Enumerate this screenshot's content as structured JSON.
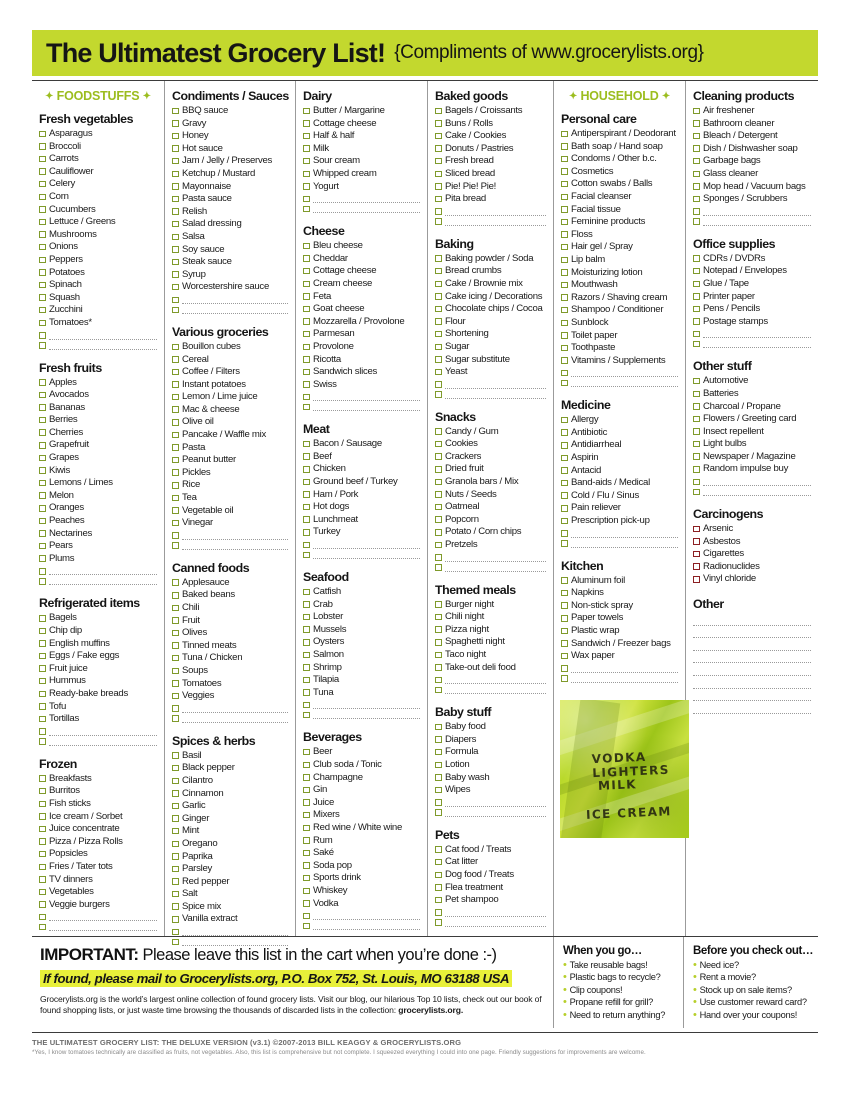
{
  "header": {
    "title": "The Ultimatest Grocery List!",
    "subtitle": "{Compliments of www.grocerylists.org}"
  },
  "banners": {
    "foodstuffs": "FOODSTUFFS",
    "household": "HOUSEHOLD"
  },
  "columns": [
    {
      "banner": "foodstuffs",
      "sections": [
        {
          "title": "Fresh vegetables",
          "items": [
            "Asparagus",
            "Broccoli",
            "Carrots",
            "Cauliflower",
            "Celery",
            "Corn",
            "Cucumbers",
            "Lettuce / Greens",
            "Mushrooms",
            "Onions",
            "Peppers",
            "Potatoes",
            "Spinach",
            "Squash",
            "Zucchini",
            "Tomatoes*"
          ],
          "blanks": 2
        },
        {
          "title": "Fresh fruits",
          "items": [
            "Apples",
            "Avocados",
            "Bananas",
            "Berries",
            "Cherries",
            "Grapefruit",
            "Grapes",
            "Kiwis",
            "Lemons / Limes",
            "Melon",
            "Oranges",
            "Peaches",
            "Nectarines",
            "Pears",
            "Plums"
          ],
          "blanks": 2
        },
        {
          "title": "Refrigerated items",
          "items": [
            "Bagels",
            "Chip dip",
            "English muffins",
            "Eggs / Fake eggs",
            "Fruit juice",
            "Hummus",
            "Ready-bake breads",
            "Tofu",
            "Tortillas"
          ],
          "blanks": 2
        },
        {
          "title": "Frozen",
          "items": [
            "Breakfasts",
            "Burritos",
            "Fish sticks",
            "Ice cream / Sorbet",
            "Juice concentrate",
            "Pizza / Pizza Rolls",
            "Popsicles",
            "Fries / Tater tots",
            "TV dinners",
            "Vegetables",
            "Veggie burgers"
          ],
          "blanks": 2
        }
      ]
    },
    {
      "sections": [
        {
          "title": "Condiments / Sauces",
          "items": [
            "BBQ sauce",
            "Gravy",
            "Honey",
            "Hot sauce",
            "Jam / Jelly / Preserves",
            "Ketchup / Mustard",
            "Mayonnaise",
            "Pasta sauce",
            "Relish",
            "Salad dressing",
            "Salsa",
            "Soy sauce",
            "Steak sauce",
            "Syrup",
            "Worcestershire sauce"
          ],
          "blanks": 2
        },
        {
          "title": "Various groceries",
          "items": [
            "Bouillon cubes",
            "Cereal",
            "Coffee / Filters",
            "Instant potatoes",
            "Lemon / Lime juice",
            "Mac & cheese",
            "Olive oil",
            "Pancake / Waffle mix",
            "Pasta",
            "Peanut butter",
            "Pickles",
            "Rice",
            "Tea",
            "Vegetable oil",
            "Vinegar"
          ],
          "blanks": 2
        },
        {
          "title": "Canned foods",
          "items": [
            "Applesauce",
            "Baked beans",
            "Chili",
            "Fruit",
            "Olives",
            "Tinned meats",
            "Tuna / Chicken",
            "Soups",
            "Tomatoes",
            "Veggies"
          ],
          "blanks": 2
        },
        {
          "title": "Spices & herbs",
          "items": [
            "Basil",
            "Black pepper",
            "Cilantro",
            "Cinnamon",
            "Garlic",
            "Ginger",
            "Mint",
            "Oregano",
            "Paprika",
            "Parsley",
            "Red pepper",
            "Salt",
            "Spice mix",
            "Vanilla extract"
          ],
          "blanks": 2
        }
      ]
    },
    {
      "sections": [
        {
          "title": "Dairy",
          "items": [
            "Butter / Margarine",
            "Cottage cheese",
            "Half & half",
            "Milk",
            "Sour cream",
            "Whipped cream",
            "Yogurt"
          ],
          "blanks": 2
        },
        {
          "title": "Cheese",
          "items": [
            "Bleu cheese",
            "Cheddar",
            "Cottage cheese",
            "Cream cheese",
            "Feta",
            "Goat cheese",
            "Mozzarella / Provolone",
            "Parmesan",
            "Provolone",
            "Ricotta",
            "Sandwich slices",
            "Swiss"
          ],
          "blanks": 2
        },
        {
          "title": "Meat",
          "items": [
            "Bacon / Sausage",
            "Beef",
            "Chicken",
            "Ground beef / Turkey",
            "Ham / Pork",
            "Hot dogs",
            "Lunchmeat",
            "Turkey"
          ],
          "blanks": 2
        },
        {
          "title": "Seafood",
          "items": [
            "Catfish",
            "Crab",
            "Lobster",
            "Mussels",
            "Oysters",
            "Salmon",
            "Shrimp",
            "Tilapia",
            "Tuna"
          ],
          "blanks": 2
        },
        {
          "title": "Beverages",
          "items": [
            "Beer",
            "Club soda / Tonic",
            "Champagne",
            "Gin",
            "Juice",
            "Mixers",
            "Red wine / White wine",
            "Rum",
            "Saké",
            "Soda pop",
            "Sports drink",
            "Whiskey",
            "Vodka"
          ],
          "blanks": 2
        }
      ]
    },
    {
      "sections": [
        {
          "title": "Baked goods",
          "items": [
            "Bagels / Croissants",
            "Buns / Rolls",
            "Cake / Cookies",
            "Donuts / Pastries",
            "Fresh bread",
            "Sliced bread",
            "Pie! Pie! Pie!",
            "Pita bread"
          ],
          "blanks": 2
        },
        {
          "title": "Baking",
          "items": [
            "Baking powder / Soda",
            "Bread crumbs",
            "Cake / Brownie mix",
            "Cake icing / Decorations",
            "Chocolate chips / Cocoa",
            "Flour",
            "Shortening",
            "Sugar",
            "Sugar substitute",
            "Yeast"
          ],
          "blanks": 2
        },
        {
          "title": "Snacks",
          "items": [
            "Candy / Gum",
            "Cookies",
            "Crackers",
            "Dried fruit",
            "Granola bars / Mix",
            "Nuts / Seeds",
            "Oatmeal",
            "Popcorn",
            "Potato / Corn chips",
            "Pretzels"
          ],
          "blanks": 2
        },
        {
          "title": "Themed meals",
          "items": [
            "Burger night",
            "Chili night",
            "Pizza night",
            "Spaghetti night",
            "Taco night",
            "Take-out deli food"
          ],
          "blanks": 2
        },
        {
          "title": "Baby stuff",
          "items": [
            "Baby food",
            "Diapers",
            "Formula",
            "Lotion",
            "Baby wash",
            "Wipes"
          ],
          "blanks": 2
        },
        {
          "title": "Pets",
          "items": [
            "Cat food / Treats",
            "Cat litter",
            "Dog food / Treats",
            "Flea treatment",
            "Pet shampoo"
          ],
          "blanks": 2
        }
      ]
    },
    {
      "banner": "household",
      "sections": [
        {
          "title": "Personal care",
          "items": [
            "Antiperspirant / Deodorant",
            "Bath soap / Hand soap",
            "Condoms / Other b.c.",
            "Cosmetics",
            "Cotton swabs / Balls",
            "Facial cleanser",
            "Facial tissue",
            "Feminine products",
            "Floss",
            "Hair gel / Spray",
            "Lip balm",
            "Moisturizing lotion",
            "Mouthwash",
            "Razors / Shaving cream",
            "Shampoo / Conditioner",
            "Sunblock",
            "Toilet paper",
            "Toothpaste",
            "Vitamins / Supplements"
          ],
          "blanks": 2
        },
        {
          "title": "Medicine",
          "items": [
            "Allergy",
            "Antibiotic",
            "Antidiarrheal",
            "Aspirin",
            "Antacid",
            "Band-aids / Medical",
            "Cold / Flu / Sinus",
            "Pain reliever",
            "Prescription pick-up"
          ],
          "blanks": 2
        },
        {
          "title": "Kitchen",
          "items": [
            "Aluminum foil",
            "Napkins",
            "Non-stick spray",
            "Paper towels",
            "Plastic wrap",
            "Sandwich / Freezer bags",
            "Wax paper"
          ],
          "blanks": 2
        }
      ]
    },
    {
      "sections": [
        {
          "title": "Cleaning products",
          "items": [
            "Air freshener",
            "Bathroom cleaner",
            "Bleach / Detergent",
            "Dish / Dishwasher soap",
            "Garbage bags",
            "Glass cleaner",
            "Mop head / Vacuum bags",
            "Sponges / Scrubbers"
          ],
          "blanks": 2
        },
        {
          "title": "Office supplies",
          "items": [
            "CDRs / DVDRs",
            "Notepad / Envelopes",
            "Glue / Tape",
            "Printer paper",
            "Pens / Pencils",
            "Postage stamps"
          ],
          "blanks": 2
        },
        {
          "title": "Other stuff",
          "items": [
            "Automotive",
            "Batteries",
            "Charcoal / Propane",
            "Flowers / Greeting card",
            "Insect repellent",
            "Light bulbs",
            "Newspaper / Magazine",
            "Random impulse buy"
          ],
          "blanks": 2
        },
        {
          "title": "Carcinogens",
          "danger": true,
          "items": [
            "Arsenic",
            "Asbestos",
            "Cigarettes",
            "Radionuclides",
            "Vinyl chloride"
          ],
          "blanks": 0
        },
        {
          "title": "Other",
          "items": [],
          "open_lines": 8
        }
      ]
    }
  ],
  "note_photo": {
    "line1": "VODKA  LIGHTERS",
    "line2": "MILK",
    "line3": "ICE CREAM"
  },
  "footer": {
    "important_label": "IMPORTANT:",
    "important_text": "Please leave this list in the cart when you’re done :-)",
    "mail_line": "If found, please mail to Grocerylists.org, P.O. Box 752, St. Louis, MO 63188 USA",
    "blurb_part1": "Grocerylists.org is the world’s largest online collection of found grocery lists. Visit our blog, our hilarious Top 10 lists, check out our book of found shopping lists, or just waste time browsing the thousands of discarded lists in the collection: ",
    "blurb_bold": "grocerylists.org.",
    "when_you_go": {
      "title": "When you go…",
      "items": [
        "Take reusable bags!",
        "Plastic bags to recycle?",
        "Clip coupons!",
        "Propane refill for grill?",
        "Need to return anything?"
      ]
    },
    "before_checkout": {
      "title": "Before you check out…",
      "items": [
        "Need ice?",
        "Rent a movie?",
        "Stock up on sale items?",
        "Use customer reward card?",
        "Hand over your coupons!"
      ]
    },
    "copyright": "THE ULTIMATEST GROCERY LIST: THE DELUXE VERSION (v3.1) ©2007-2013 BILL KEAGGY & GROCERYLISTS.ORG",
    "disclaimer": "*Yes, I know tomatoes technically are classified as fruits, not vegetables. Also, this list is comprehensive but not complete. I squeezed everything I could into one page. Friendly suggestions for improvements are welcome."
  }
}
